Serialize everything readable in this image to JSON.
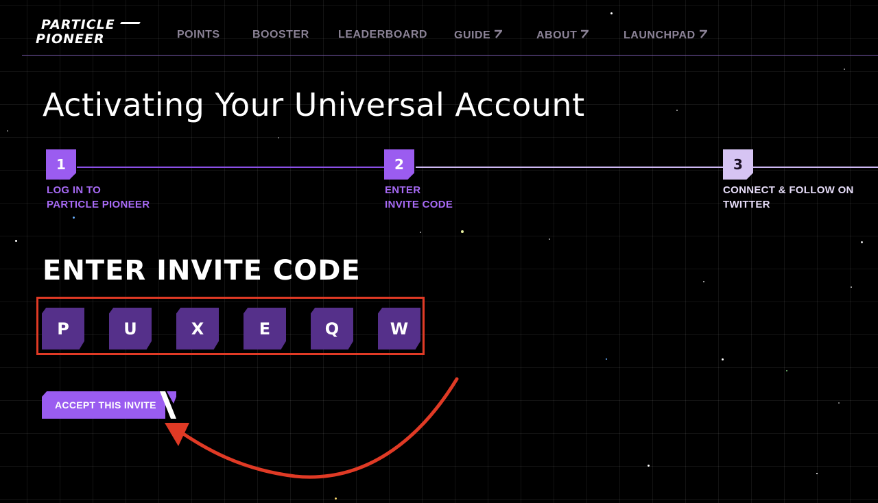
{
  "header": {
    "logo_line1": "PARTICLE",
    "logo_line2": "PIONEER",
    "nav": [
      {
        "label": "POINTS",
        "external": false
      },
      {
        "label": "BOOSTER",
        "external": false
      },
      {
        "label": "LEADERBOARD",
        "external": false
      },
      {
        "label": "GUIDE",
        "external": true
      },
      {
        "label": "ABOUT",
        "external": true
      },
      {
        "label": "LAUNCHPAD",
        "external": true
      }
    ],
    "external_glyph": "⁄"
  },
  "page_title": "Activating Your Universal Account",
  "steps": [
    {
      "number": "1",
      "label_line1": "LOG IN TO",
      "label_line2": "PARTICLE PIONEER",
      "state": "complete"
    },
    {
      "number": "2",
      "label_line1": "ENTER",
      "label_line2": "INVITE CODE",
      "state": "current"
    },
    {
      "number": "3",
      "label_line1": "CONNECT & FOLLOW ON",
      "label_line2": "TWITTER",
      "state": "upcoming"
    }
  ],
  "invite": {
    "heading": "ENTER INVITE CODE",
    "code": [
      "P",
      "U",
      "X",
      "E",
      "Q",
      "W"
    ],
    "accept_label": "ACCEPT THIS INVITE"
  },
  "colors": {
    "accent": "#9b5cf0",
    "code_cell": "#55308a",
    "highlight": "#e03a25",
    "nav_text": "#8b8296"
  }
}
